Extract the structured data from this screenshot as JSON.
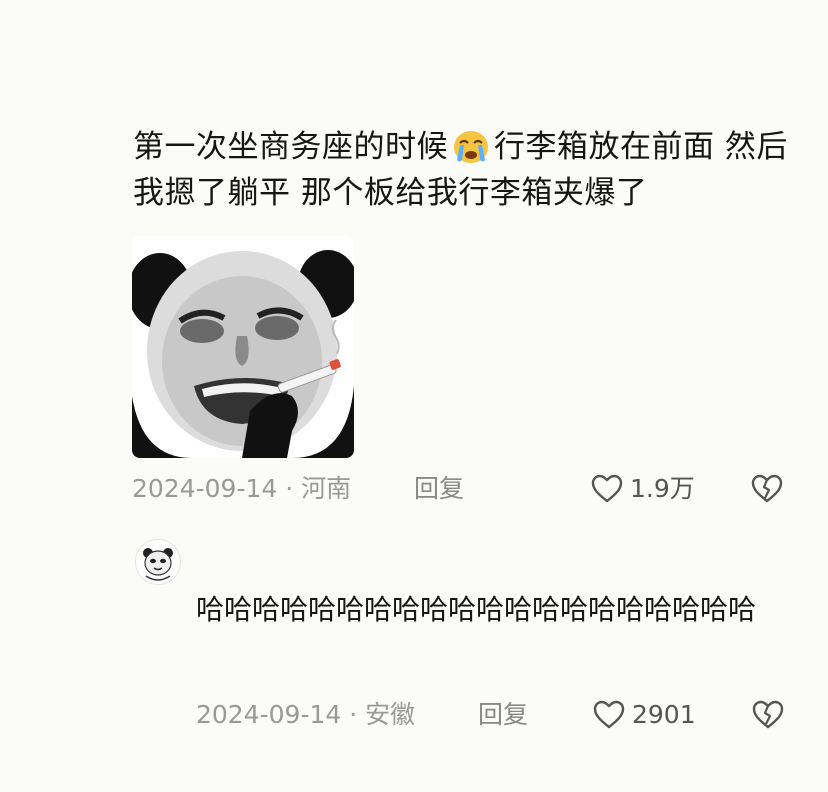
{
  "comment": {
    "text_before_emoji": "第一次坐商务座的时候",
    "emoji": "crying-face-emoji",
    "text_after_emoji": "行李箱放在前面 然后我摁了躺平 那个板给我行李箱夹爆了",
    "date": "2024-09-14",
    "location": "河南",
    "reply_label": "回复",
    "likes": "1.9万"
  },
  "reply": {
    "text": "哈哈哈哈哈哈哈哈哈哈哈哈哈哈哈哈哈哈哈哈",
    "date": "2024-09-14",
    "location": "安徽",
    "reply_label": "回复",
    "likes": "2901"
  },
  "colors": {
    "background": "#fbfbf8",
    "text": "#161616",
    "meta": "#999999"
  }
}
